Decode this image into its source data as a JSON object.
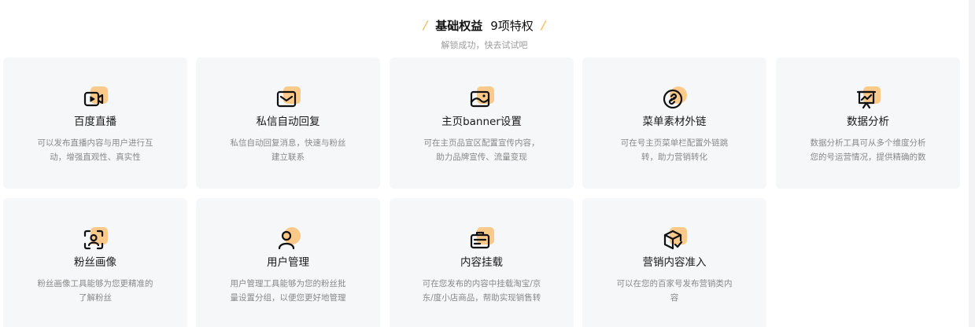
{
  "header": {
    "title": "基础权益",
    "count": "9项特权",
    "subtitle": "解锁成功，快去试试吧"
  },
  "cards": [
    {
      "title": "百度直播",
      "icon": "live-video-icon",
      "desc": [
        "可以发布直播内容与用户进行互",
        "动，增强直观性、真实性"
      ]
    },
    {
      "title": "私信自动回复",
      "icon": "mail-reply-icon",
      "desc": [
        "私信自动回复消息，快速与粉丝",
        "建立联系"
      ]
    },
    {
      "title": "主页banner设置",
      "icon": "banner-image-icon",
      "desc": [
        "可在主页品宣区配置宣传内容，",
        "助力品牌宣传、流量变现"
      ]
    },
    {
      "title": "菜单素材外链",
      "icon": "link-icon",
      "desc": [
        "可在号主页菜单栏配置外链跳",
        "转，助力营销转化"
      ]
    },
    {
      "title": "数据分析",
      "icon": "chart-board-icon",
      "desc": [
        "数据分析工具可从多个维度分析",
        "您的号运营情况，提供精确的数"
      ]
    },
    {
      "title": "粉丝画像",
      "icon": "fan-portrait-icon",
      "desc": [
        "粉丝画像工具能够为您更精准的",
        "了解粉丝"
      ]
    },
    {
      "title": "用户管理",
      "icon": "user-icon",
      "desc": [
        "用户管理工具能够为您的粉丝批",
        "量设置分组，以便您更好地管理"
      ]
    },
    {
      "title": "内容挂载",
      "icon": "content-mount-icon",
      "desc": [
        "可在您发布的内容中挂载淘宝/京",
        "东/度小店商品，帮助实现销售转"
      ]
    },
    {
      "title": "营销内容准入",
      "icon": "package-check-icon",
      "desc": [
        "可以在您的百家号发布营销类内",
        "容"
      ]
    }
  ]
}
